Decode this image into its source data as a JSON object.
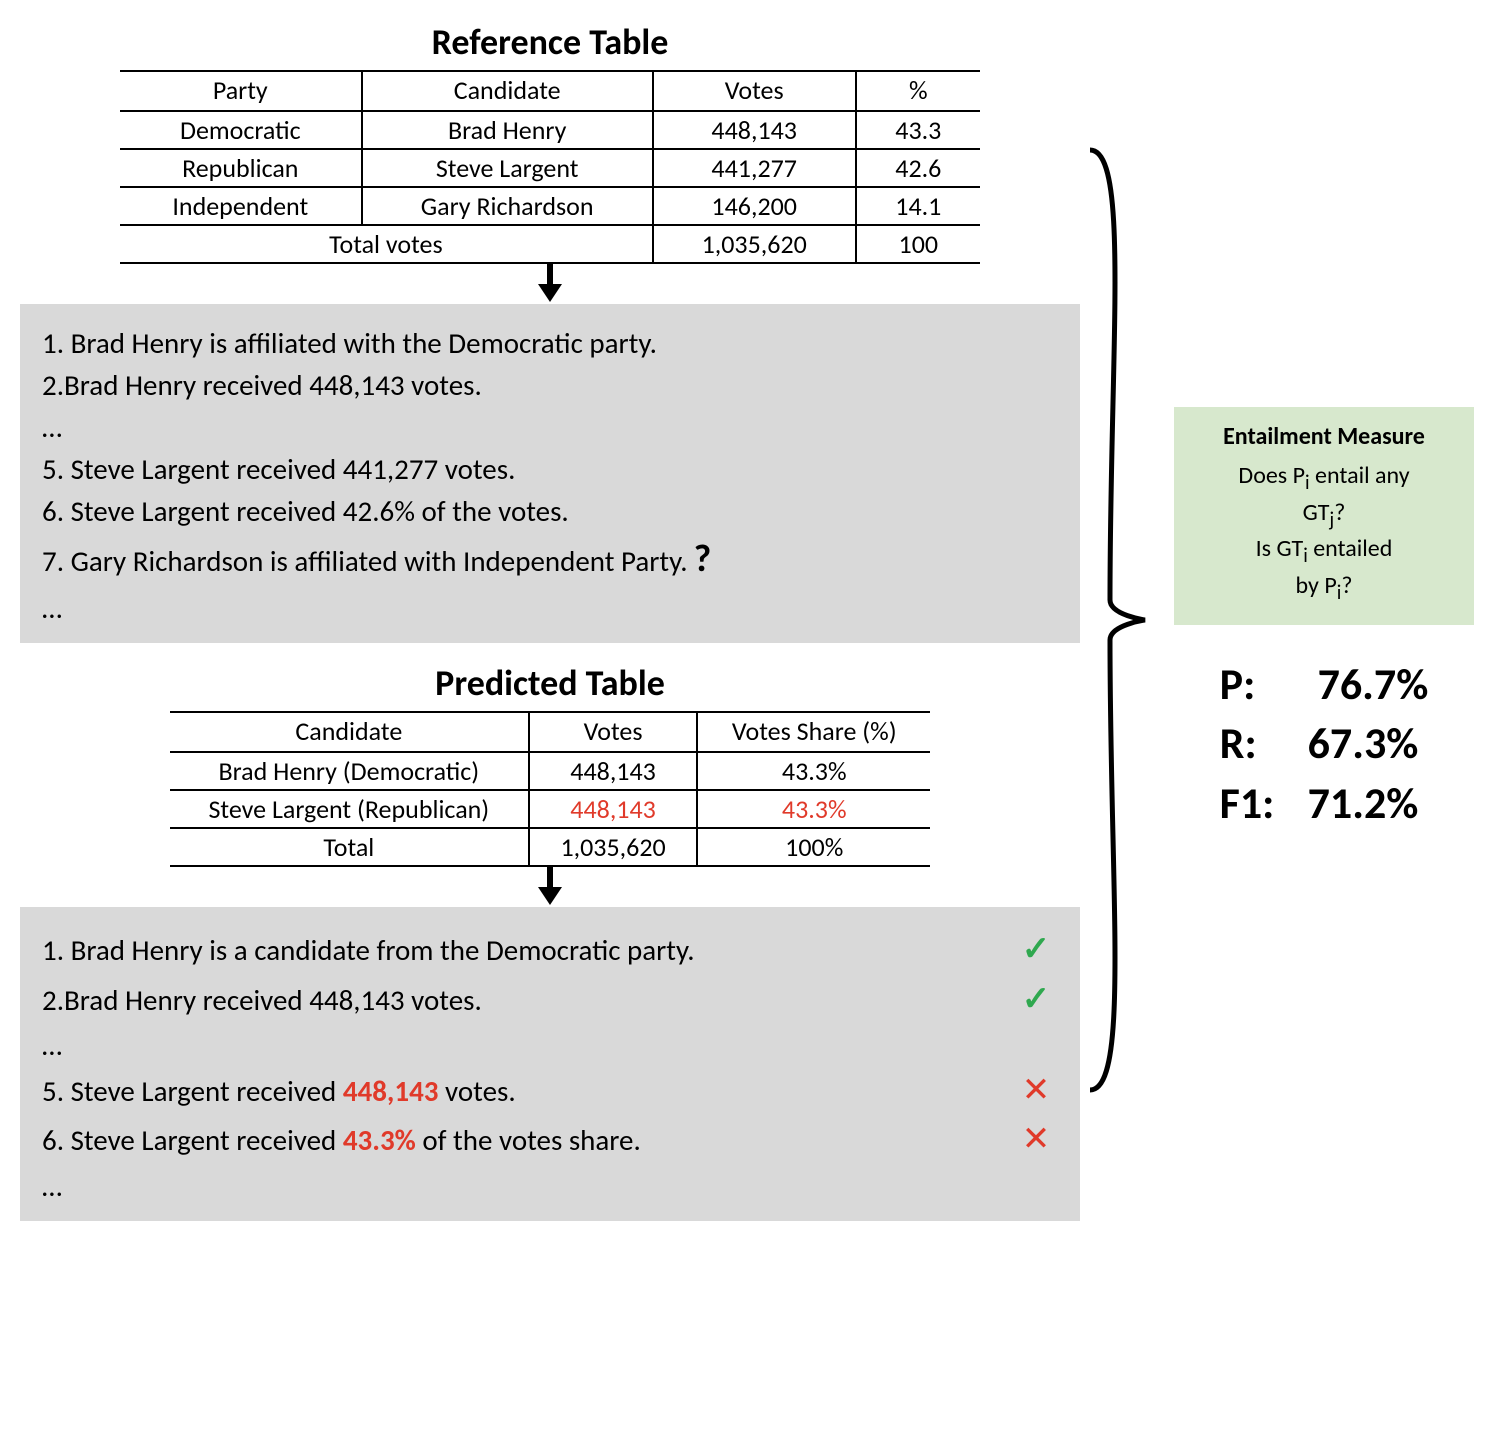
{
  "reference": {
    "title": "Reference Table",
    "headers": [
      "Party",
      "Candidate",
      "Votes",
      "%"
    ],
    "rows": [
      [
        "Democratic",
        "Brad Henry",
        "448,143",
        "43.3"
      ],
      [
        "Republican",
        "Steve Largent",
        "441,277",
        "42.6"
      ],
      [
        "Independent",
        "Gary Richardson",
        "146,200",
        "14.1"
      ]
    ],
    "total": {
      "label": "Total votes",
      "votes": "1,035,620",
      "pct": "100"
    }
  },
  "ref_facts": {
    "lines": [
      "1. Brad Henry is affiliated with the Democratic party.",
      "2.Brad Henry received 448,143 votes.",
      "…",
      "5. Steve Largent received 441,277 votes.",
      "6. Steve Largent received 42.6% of the votes.",
      "7. Gary Richardson is affiliated with Independent Party.",
      "…"
    ],
    "question_mark": "?"
  },
  "predicted": {
    "title": "Predicted Table",
    "headers": [
      "Candidate",
      "Votes",
      "Votes Share (%)"
    ],
    "rows": [
      {
        "cells": [
          "Brad Henry (Democratic)",
          "448,143",
          "43.3%"
        ],
        "red": []
      },
      {
        "cells": [
          "Steve Largent (Republican)",
          "448,143",
          "43.3%"
        ],
        "red": [
          1,
          2
        ]
      }
    ],
    "total": {
      "label": "Total",
      "votes": "1,035,620",
      "pct": "100%"
    }
  },
  "pred_facts": {
    "lines": [
      {
        "prefix": "1. Brad Henry is a candidate from the Democratic party.",
        "red": "",
        "suffix": "",
        "mark": "check"
      },
      {
        "prefix": "2.Brad Henry received 448,143 votes.",
        "red": "",
        "suffix": "",
        "mark": "check"
      },
      {
        "prefix": "…",
        "red": "",
        "suffix": "",
        "mark": ""
      },
      {
        "prefix": "5. Steve Largent received ",
        "red": "448,143",
        "suffix": " votes.",
        "mark": "x"
      },
      {
        "prefix": "6. Steve Largent received ",
        "red": "43.3%",
        "suffix": " of the votes share.",
        "mark": "x"
      },
      {
        "prefix": "…",
        "red": "",
        "suffix": "",
        "mark": ""
      }
    ]
  },
  "entailment": {
    "title": "Entailment Measure",
    "q1a": "Does P",
    "q1b": " entail any",
    "q1c": "GT",
    "q1d": "?",
    "q2a": "Is GT",
    "q2b": " entailed",
    "q2c": "by P",
    "q2d": "?",
    "sub_i": "i",
    "sub_j": "j"
  },
  "metrics": {
    "p_label": "P:",
    "p_val": "76.7%",
    "r_label": "R:",
    "r_val": "67.3%",
    "f1_label": "F1:",
    "f1_val": "71.2%"
  }
}
